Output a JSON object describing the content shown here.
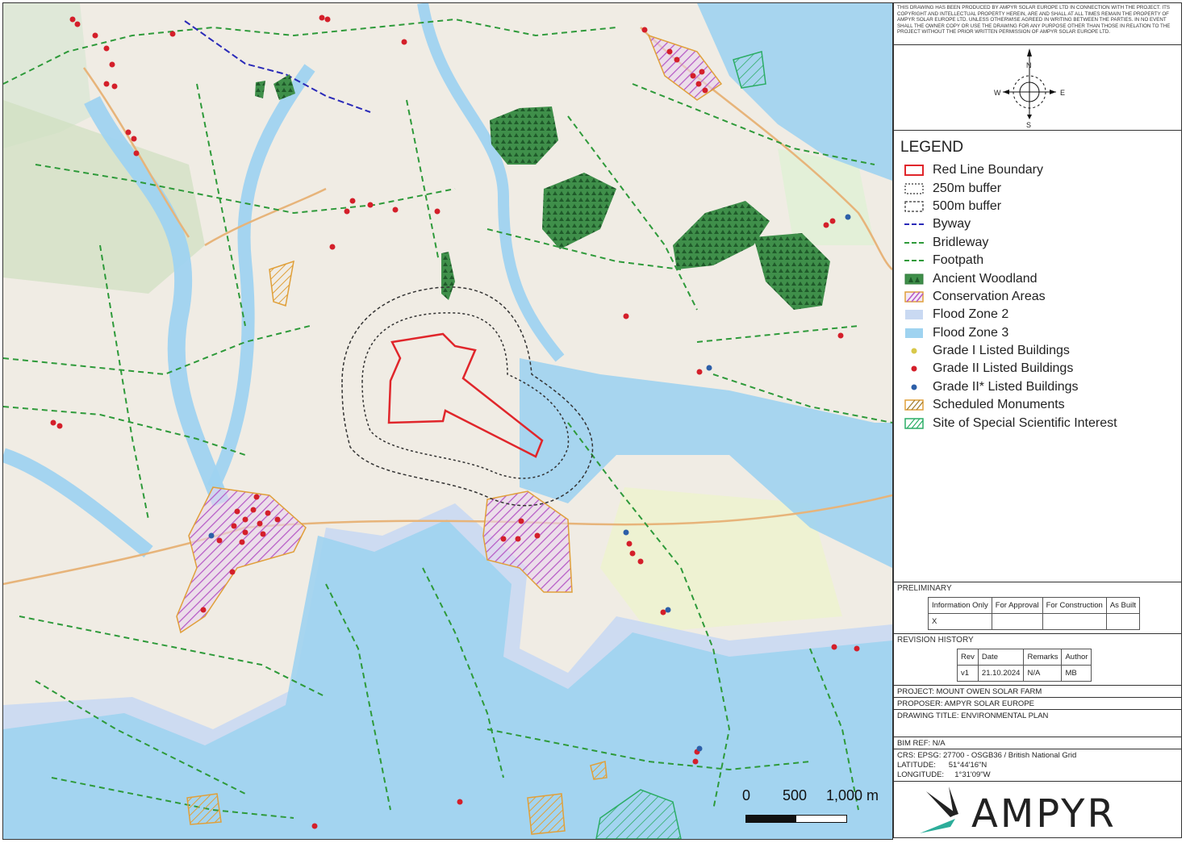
{
  "map": {
    "scale_labels": [
      "0",
      "500",
      "1,000 m"
    ]
  },
  "disclaimer": "THIS DRAWING HAS BEEN PRODUCED BY AMPYR SOLAR EUROPE LTD IN CONNECTION WITH THE PROJECT. ITS COPYRIGHT AND INTELLECTUAL PROPERTY HEREIN, ARE AND SHALL AT ALL TIMES REMAIN THE PROPERTY OF AMPYR SOLAR EUROPE LTD. UNLESS OTHERWISE AGREED IN WRITING BETWEEN THE PARTIES. IN NO EVENT SHALL THE OWNER COPY OR USE THE DRAWING FOR ANY PURPOSE OTHER THAN THOSE IN RELATION TO THE PROJECT WITHOUT THE PRIOR WRITTEN PERMISSION OF AMPYR SOLAR EUROPE LTD.",
  "compass": {
    "n": "N",
    "e": "E",
    "s": "S",
    "w": "W"
  },
  "legend": {
    "title": "LEGEND",
    "items": [
      {
        "label": "Red Line Boundary",
        "sym": "red-line-boundary-icon"
      },
      {
        "label": "250m buffer",
        "sym": "buffer-250m-icon"
      },
      {
        "label": "500m buffer",
        "sym": "buffer-500m-icon"
      },
      {
        "label": "Byway",
        "sym": "byway-line-icon"
      },
      {
        "label": "Bridleway",
        "sym": "bridleway-line-icon"
      },
      {
        "label": "Footpath",
        "sym": "footpath-line-icon"
      },
      {
        "label": "Ancient Woodland",
        "sym": "ancient-woodland-icon"
      },
      {
        "label": "Conservation Areas",
        "sym": "conservation-area-icon"
      },
      {
        "label": "Flood Zone 2",
        "sym": "flood-zone-2-icon"
      },
      {
        "label": "Flood Zone 3",
        "sym": "flood-zone-3-icon"
      },
      {
        "label": "Grade I Listed Buildings",
        "sym": "grade-1-dot-icon"
      },
      {
        "label": "Grade II Listed Buildings",
        "sym": "grade-2-dot-icon"
      },
      {
        "label": "Grade II* Listed Buildings",
        "sym": "grade-2-star-dot-icon"
      },
      {
        "label": "Scheduled Monuments",
        "sym": "scheduled-monument-icon"
      },
      {
        "label": "Site of Special Scientific Interest",
        "sym": "sssi-icon"
      }
    ]
  },
  "preliminary": {
    "title": "PRELIMINARY",
    "headers": [
      "Information Only",
      "For Approval",
      "For Construction",
      "As Built"
    ],
    "values": [
      "X",
      "",
      "",
      ""
    ]
  },
  "revision": {
    "title": "REVISION HISTORY",
    "headers": [
      "Rev",
      "Date",
      "Remarks",
      "Author"
    ],
    "values": [
      "v1",
      "21.10.2024",
      "N/A",
      "MB"
    ]
  },
  "project": "PROJECT: MOUNT OWEN SOLAR FARM",
  "proposer": "PROPOSER: AMPYR SOLAR EUROPE",
  "drawing_title": "DRAWING TITLE: ENVIRONMENTAL PLAN",
  "bim_ref": "BIM REF: N/A",
  "crs": {
    "line1": "CRS: EPSG: 27700 - OSGB36 / British National Grid",
    "line2": "LATITUDE:      51°44'16\"N",
    "line3": "LONGITUDE:     1°31'09\"W"
  },
  "logo_text": "AMPYR",
  "colors": {
    "red_line": "#e0262b",
    "byway": "#2a2ab8",
    "path": "#2e9a3a",
    "woodland": "#2f7a3a",
    "conservation": "#b65ac6",
    "flood2": "#c9d9f2",
    "flood3": "#9fd3f0",
    "grade1": "#d8c84a",
    "grade2": "#d41f2a",
    "grade2star": "#2d5fa8",
    "monument": "#e0a03a",
    "sssi": "#2cad66"
  }
}
